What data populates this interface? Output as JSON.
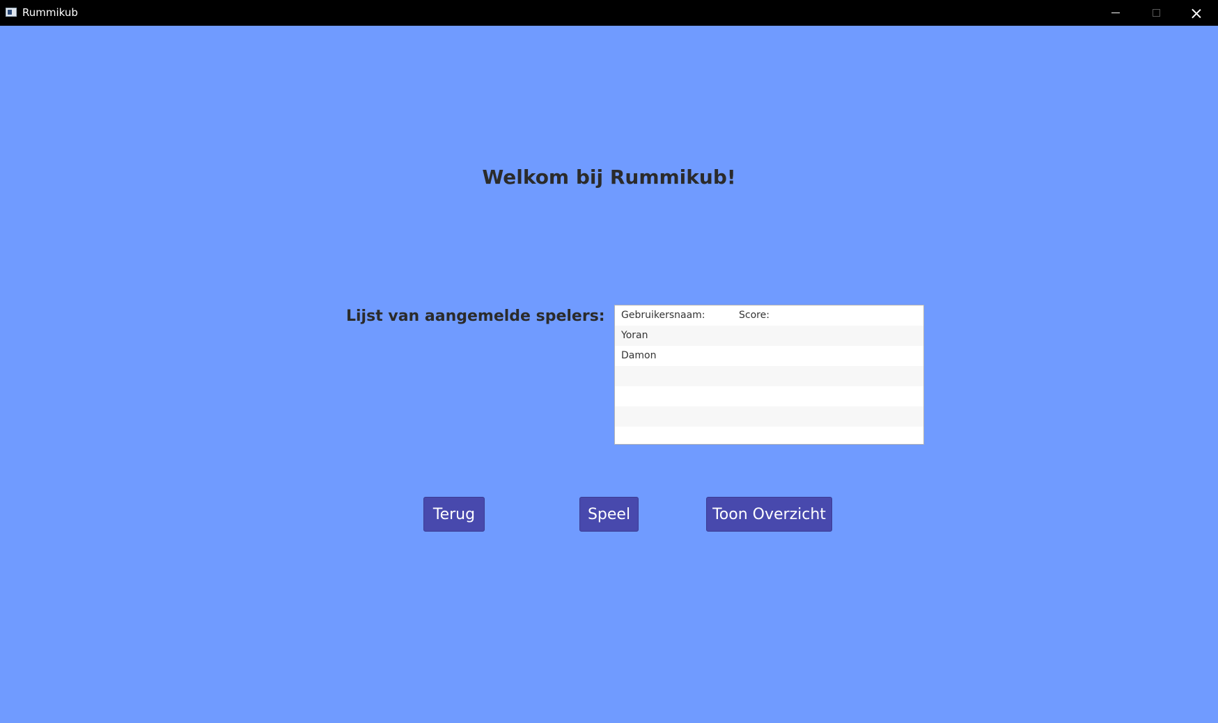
{
  "window": {
    "title": "Rummikub",
    "controls": [
      "minimize-icon",
      "maximize-icon",
      "close-icon"
    ]
  },
  "main": {
    "welcome": "Welkom bij Rummikub!",
    "players_label": "Lijst van aangemelde spelers:",
    "table": {
      "headers": [
        "Gebruikersnaam:",
        "Score:"
      ],
      "rows": [
        {
          "name": "Yoran",
          "score": ""
        },
        {
          "name": "Damon",
          "score": ""
        },
        {
          "name": "",
          "score": ""
        },
        {
          "name": "",
          "score": ""
        },
        {
          "name": "",
          "score": ""
        },
        {
          "name": "",
          "score": ""
        }
      ]
    },
    "buttons": {
      "back": "Terug",
      "play": "Speel",
      "overview": "Toon Overzicht"
    }
  },
  "colors": {
    "background": "#709bff",
    "button": "#4849ad",
    "titlebar": "#000000"
  }
}
